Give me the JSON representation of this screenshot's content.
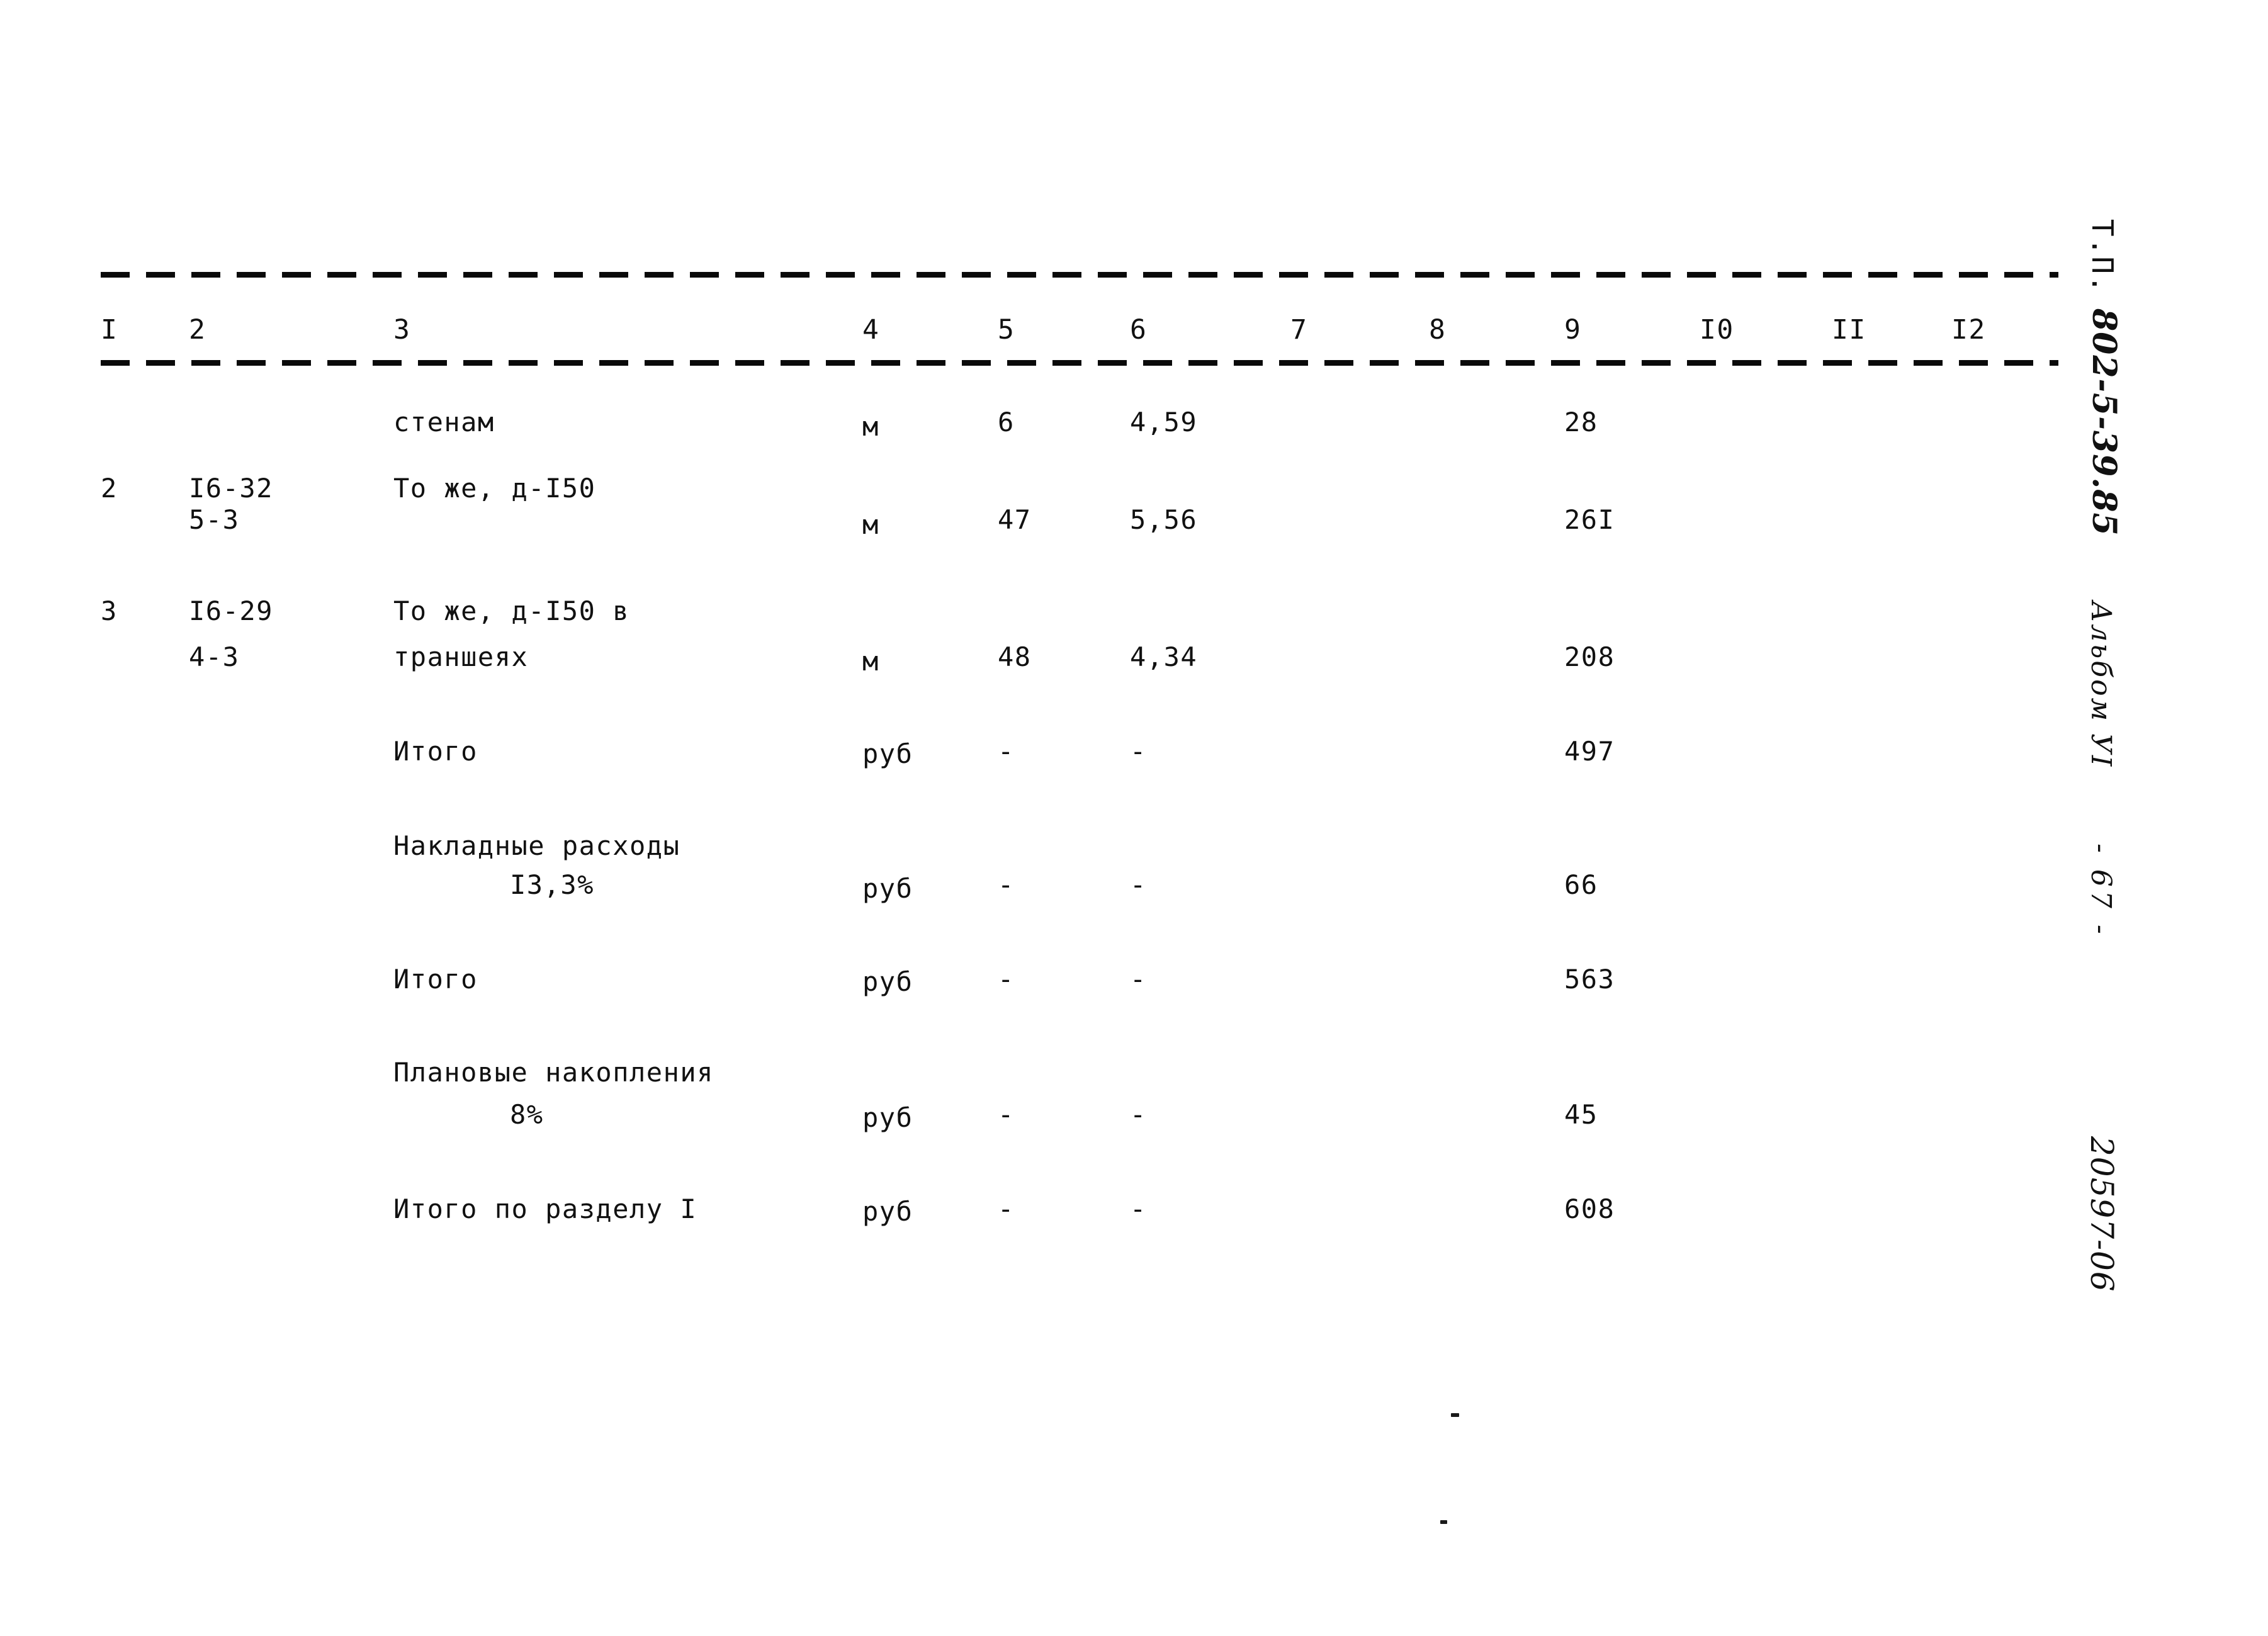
{
  "document": {
    "type_label": "Т.П.",
    "type_code": "802-5-39.85",
    "album": "Альбом УI",
    "page_marker": "- 67 -",
    "doc_code": "20597-06"
  },
  "table": {
    "column_numbers": [
      "I",
      "2",
      "3",
      "4",
      "5",
      "6",
      "7",
      "8",
      "9",
      "I0",
      "II",
      "I2"
    ],
    "rows": [
      {
        "c1": "",
        "c2": "",
        "c2b": "",
        "c3": "стенам",
        "c3b": "",
        "c4": "м",
        "c5": "6",
        "c6": "4,59",
        "c7": "",
        "c8": "",
        "c9": "28",
        "c10": "",
        "c11": "",
        "c12": ""
      },
      {
        "c1": "2",
        "c2": "I6-32",
        "c2b": "5-3",
        "c3": "То же, д-I50",
        "c3b": "",
        "c4": "м",
        "c5": "47",
        "c6": "5,56",
        "c7": "",
        "c8": "",
        "c9": "26I",
        "c10": "",
        "c11": "",
        "c12": ""
      },
      {
        "c1": "3",
        "c2": "I6-29",
        "c2b": "4-3",
        "c3": "То же, д-I50 в",
        "c3b": "траншеях",
        "c4": "м",
        "c5": "48",
        "c6": "4,34",
        "c7": "",
        "c8": "",
        "c9": "208",
        "c10": "",
        "c11": "",
        "c12": ""
      },
      {
        "c1": "",
        "c2": "",
        "c2b": "",
        "c3": "Итого",
        "c3b": "",
        "c4": "руб",
        "c5": "-",
        "c6": "-",
        "c7": "",
        "c8": "",
        "c9": "497",
        "c10": "",
        "c11": "",
        "c12": ""
      },
      {
        "c1": "",
        "c2": "",
        "c2b": "",
        "c3": "Накладные расходы",
        "c3b": "I3,3%",
        "c4": "руб",
        "c5": "-",
        "c6": "-",
        "c7": "",
        "c8": "",
        "c9": "66",
        "c10": "",
        "c11": "",
        "c12": ""
      },
      {
        "c1": "",
        "c2": "",
        "c2b": "",
        "c3": "Итого",
        "c3b": "",
        "c4": "руб",
        "c5": "-",
        "c6": "-",
        "c7": "",
        "c8": "",
        "c9": "563",
        "c10": "",
        "c11": "",
        "c12": ""
      },
      {
        "c1": "",
        "c2": "",
        "c2b": "",
        "c3": "Плановые накопления",
        "c3b": "8%",
        "c4": "руб",
        "c5": "-",
        "c6": "-",
        "c7": "",
        "c8": "",
        "c9": "45",
        "c10": "",
        "c11": "",
        "c12": ""
      },
      {
        "c1": "",
        "c2": "",
        "c2b": "",
        "c3": "Итого по разделу I",
        "c3b": "",
        "c4": "руб",
        "c5": "-",
        "c6": "-",
        "c7": "",
        "c8": "",
        "c9": "608",
        "c10": "",
        "c11": "",
        "c12": ""
      }
    ]
  }
}
